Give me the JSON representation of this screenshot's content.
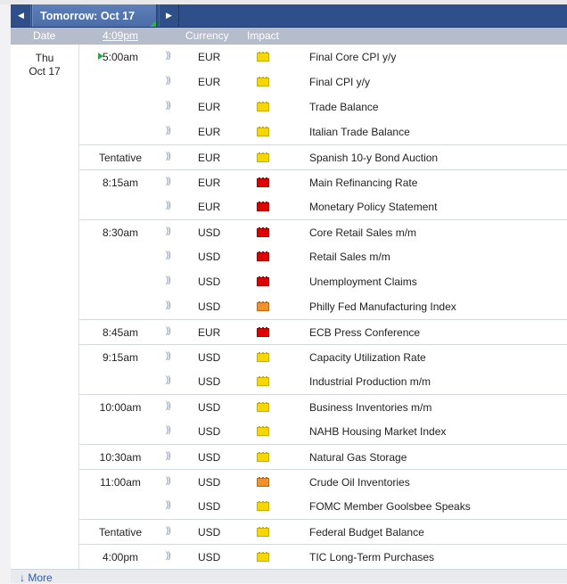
{
  "nav": {
    "title": "Tomorrow: Oct 17",
    "prev_icon": "◀",
    "next_icon": "▶"
  },
  "header": {
    "date": "Date",
    "time": "4:09pm",
    "currency": "Currency",
    "impact": "Impact"
  },
  "date": {
    "weekday": "Thu",
    "day": "Oct 17"
  },
  "sound_icon": "))",
  "rows": [
    {
      "time": "5:00am",
      "currency": "EUR",
      "impact": "yellow",
      "event": "Final Core CPI y/y"
    },
    {
      "time": "",
      "currency": "EUR",
      "impact": "yellow",
      "event": "Final CPI y/y"
    },
    {
      "time": "",
      "currency": "EUR",
      "impact": "yellow",
      "event": "Trade Balance"
    },
    {
      "time": "",
      "currency": "EUR",
      "impact": "yellow",
      "event": "Italian Trade Balance"
    },
    {
      "time": "Tentative",
      "currency": "EUR",
      "impact": "yellow",
      "event": "Spanish 10-y Bond Auction"
    },
    {
      "time": "8:15am",
      "currency": "EUR",
      "impact": "red",
      "event": "Main Refinancing Rate"
    },
    {
      "time": "",
      "currency": "EUR",
      "impact": "red",
      "event": "Monetary Policy Statement"
    },
    {
      "time": "8:30am",
      "currency": "USD",
      "impact": "red",
      "event": "Core Retail Sales m/m"
    },
    {
      "time": "",
      "currency": "USD",
      "impact": "red",
      "event": "Retail Sales m/m"
    },
    {
      "time": "",
      "currency": "USD",
      "impact": "red",
      "event": "Unemployment Claims"
    },
    {
      "time": "",
      "currency": "USD",
      "impact": "orange",
      "event": "Philly Fed Manufacturing Index"
    },
    {
      "time": "8:45am",
      "currency": "EUR",
      "impact": "red",
      "event": "ECB Press Conference"
    },
    {
      "time": "9:15am",
      "currency": "USD",
      "impact": "yellow",
      "event": "Capacity Utilization Rate"
    },
    {
      "time": "",
      "currency": "USD",
      "impact": "yellow",
      "event": "Industrial Production m/m"
    },
    {
      "time": "10:00am",
      "currency": "USD",
      "impact": "yellow",
      "event": "Business Inventories m/m"
    },
    {
      "time": "",
      "currency": "USD",
      "impact": "yellow",
      "event": "NAHB Housing Market Index"
    },
    {
      "time": "10:30am",
      "currency": "USD",
      "impact": "yellow",
      "event": "Natural Gas Storage"
    },
    {
      "time": "11:00am",
      "currency": "USD",
      "impact": "orange",
      "event": "Crude Oil Inventories"
    },
    {
      "time": "",
      "currency": "USD",
      "impact": "yellow",
      "event": "FOMC Member Goolsbee Speaks"
    },
    {
      "time": "Tentative",
      "currency": "USD",
      "impact": "yellow",
      "event": "Federal Budget Balance"
    },
    {
      "time": "4:00pm",
      "currency": "USD",
      "impact": "yellow",
      "event": "TIC Long-Term Purchases"
    }
  ],
  "footer": {
    "more": "More",
    "more_icon": "↓"
  },
  "colors": {
    "nav_bg": "#2e4f8a",
    "header_bg": "#b5bccb",
    "high_impact": "#e00000",
    "medium_impact": "#f0912c",
    "low_impact": "#f6d800"
  }
}
